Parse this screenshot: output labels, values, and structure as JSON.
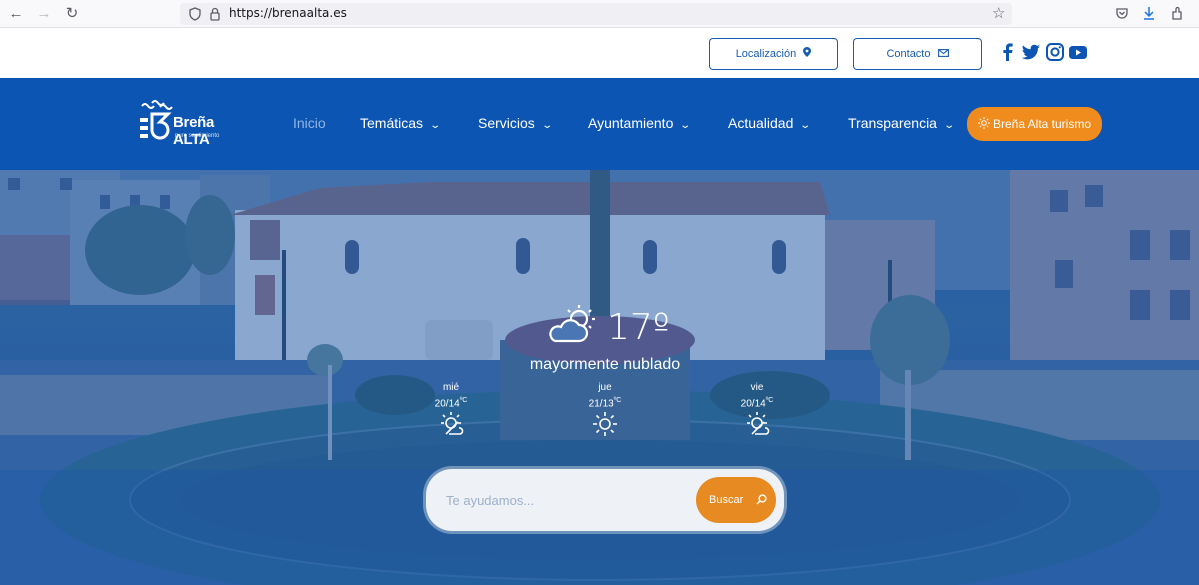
{
  "browser": {
    "url": "https://brenaalta.es",
    "back_icon": "←",
    "forward_icon": "→",
    "reload_icon": "↻",
    "bookmark_icon": "☆"
  },
  "util": {
    "location_label": "Localización",
    "contact_label": "Contacto"
  },
  "logo": {
    "name": "Breña ALTA",
    "tagline": "puro sentimiento"
  },
  "nav": {
    "items": [
      {
        "label": "Inicio"
      },
      {
        "label": "Temáticas"
      },
      {
        "label": "Servicios"
      },
      {
        "label": "Ayuntamiento"
      },
      {
        "label": "Actualidad"
      },
      {
        "label": "Transparencia"
      }
    ],
    "tourism_label": "Breña Alta turismo"
  },
  "weather": {
    "temp": "17º",
    "desc": "mayormente nublado",
    "days": [
      {
        "name": "mié",
        "temp": "20/14",
        "unit": "ºC",
        "icon": "partly-cloudy-icon"
      },
      {
        "name": "jue",
        "temp": "21/13",
        "unit": "ºC",
        "icon": "sun-icon"
      },
      {
        "name": "vie",
        "temp": "20/14",
        "unit": "ºC",
        "icon": "partly-cloudy-icon"
      }
    ]
  },
  "search": {
    "placeholder": "Te ayudamos...",
    "button_label": "Buscar"
  },
  "colors": {
    "brand_blue": "#0d55b3",
    "accent_orange": "#f08c1d"
  }
}
